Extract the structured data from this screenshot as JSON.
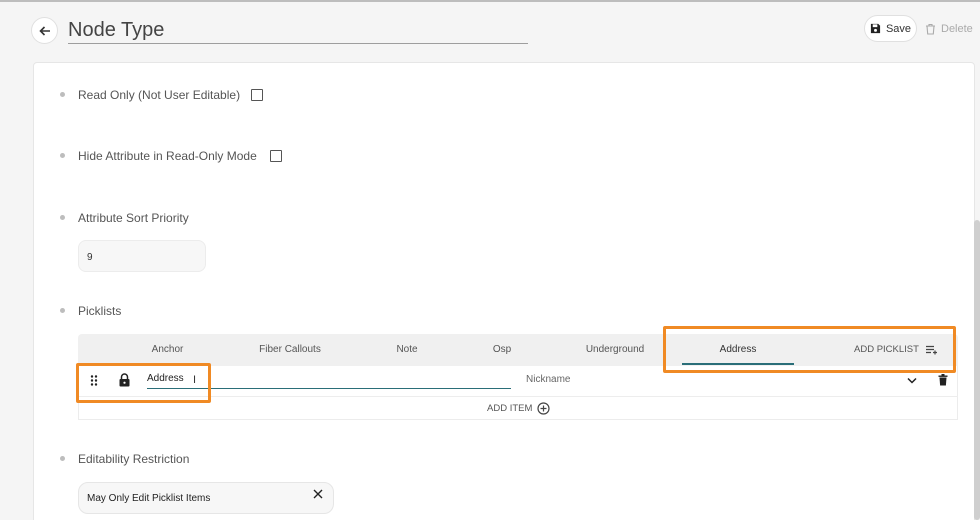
{
  "header": {
    "title": "Node Type",
    "save_label": "Save",
    "delete_label": "Delete"
  },
  "fields": {
    "read_only": {
      "label": "Read Only (Not User Editable)",
      "checked": false
    },
    "hide_attr": {
      "label": "Hide Attribute in Read-Only Mode",
      "checked": false
    },
    "sort_priority": {
      "label": "Attribute Sort Priority",
      "value": "9"
    },
    "picklists": {
      "label": "Picklists"
    },
    "editability": {
      "label": "Editability Restriction",
      "value": "May Only Edit Picklist Items"
    }
  },
  "picklist_tabs": [
    "Anchor",
    "Fiber Callouts",
    "Note",
    "Osp",
    "Underground",
    "Address"
  ],
  "picklist_active_tab": "Address",
  "add_picklist_label": "ADD PICKLIST",
  "item_row": {
    "value": "Address",
    "nickname_placeholder": "Nickname"
  },
  "add_item_label": "ADD ITEM",
  "colors": {
    "accent": "#2a6e78",
    "highlight": "#f08a24"
  },
  "icons": [
    "back-arrow-icon",
    "save-disk-icon",
    "trash-icon",
    "drag-handle-icon",
    "lock-icon",
    "add-picklist-icon",
    "chevron-down-icon",
    "add-circle-icon",
    "close-icon",
    "text-cursor-icon"
  ]
}
